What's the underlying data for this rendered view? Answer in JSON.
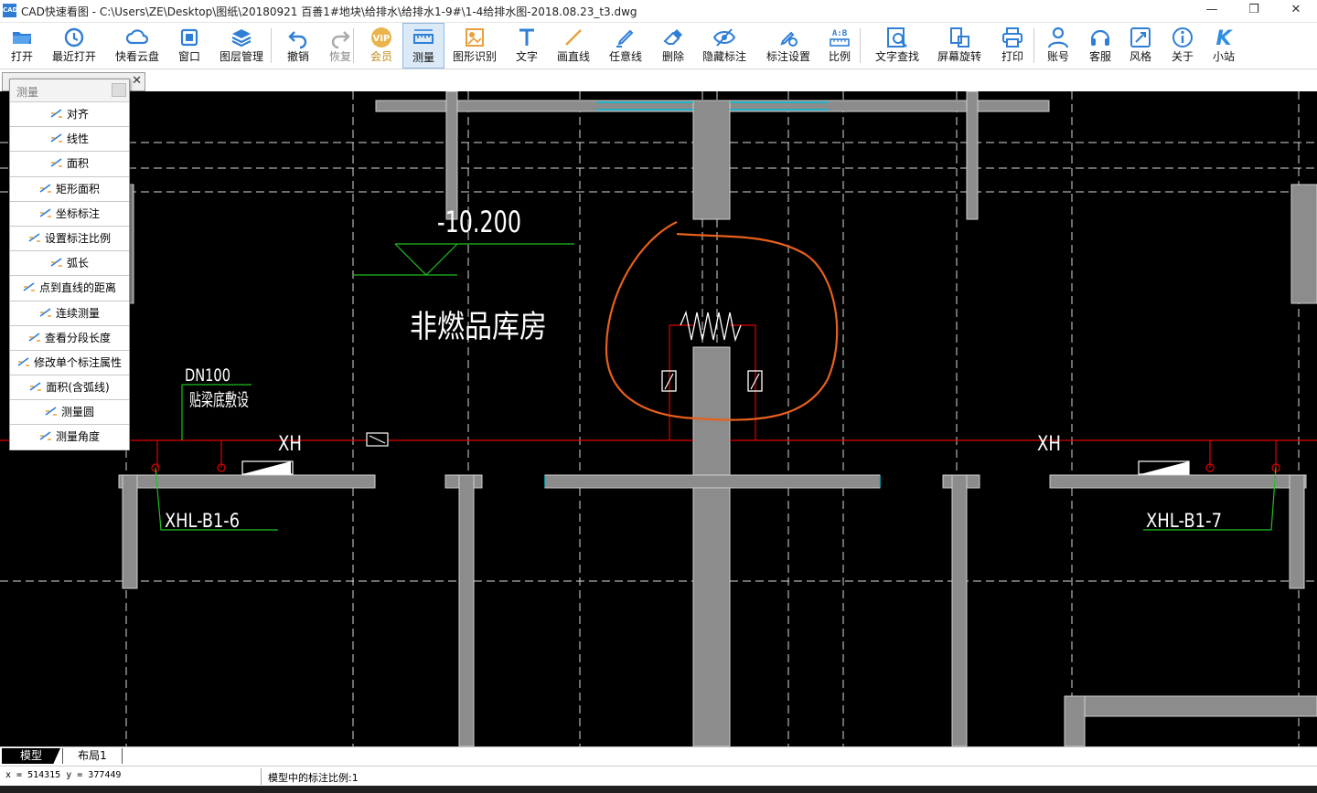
{
  "window": {
    "app_name": "CAD快速看图",
    "file_path": "C:\\Users\\ZE\\Desktop\\图纸\\20180921 百善1#地块\\给排水\\给排水1-9#\\1-4给排水图-2018.08.23_t3.dwg",
    "icon_text": "CAD",
    "controls": [
      "—",
      "❐",
      "✕"
    ]
  },
  "toolbar": [
    {
      "label": "打开",
      "icon": "folder-open"
    },
    {
      "label": "最近打开",
      "icon": "history"
    },
    {
      "label": "快看云盘",
      "icon": "cloud"
    },
    {
      "label": "窗口",
      "icon": "window"
    },
    {
      "label": "图层管理",
      "icon": "layers"
    },
    {
      "label": "撤销",
      "icon": "undo"
    },
    {
      "label": "恢复",
      "icon": "redo"
    },
    {
      "label": "会员",
      "icon": "vip"
    },
    {
      "label": "测量",
      "icon": "ruler"
    },
    {
      "label": "图形识别",
      "icon": "shape-recognize"
    },
    {
      "label": "文字",
      "icon": "text"
    },
    {
      "label": "画直线",
      "icon": "line"
    },
    {
      "label": "任意线",
      "icon": "pen"
    },
    {
      "label": "删除",
      "icon": "eraser"
    },
    {
      "label": "隐藏标注",
      "icon": "eye-hide"
    },
    {
      "label": "标注设置",
      "icon": "annotation-settings"
    },
    {
      "label": "比例",
      "icon": "scale"
    },
    {
      "label": "文字查找",
      "icon": "text-search"
    },
    {
      "label": "屏幕旋转",
      "icon": "rotate-screen"
    },
    {
      "label": "打印",
      "icon": "printer"
    },
    {
      "label": "账号",
      "icon": "user"
    },
    {
      "label": "客服",
      "icon": "headset"
    },
    {
      "label": "风格",
      "icon": "style"
    },
    {
      "label": "关于",
      "icon": "info"
    },
    {
      "label": "小站",
      "icon": "k-logo"
    }
  ],
  "tab": {
    "close": "✕"
  },
  "measure_panel": {
    "title": "测量",
    "items": [
      "对齐",
      "线性",
      "面积",
      "矩形面积",
      "坐标标注",
      "设置标注比例",
      "弧长",
      "点到直线的距离",
      "连续测量",
      "查看分段长度",
      "修改单个标注属性",
      "面积(含弧线)",
      "测量圆",
      "测量角度"
    ]
  },
  "drawing": {
    "elevation": "-10.200",
    "room_name": "非燃品库房",
    "pipe_size": "DN100",
    "pipe_note": "贴梁底敷设",
    "pipe_label_left": "XH",
    "pipe_label_right": "XH",
    "riser_left": "XHL-B1-6",
    "riser_right": "XHL-B1-7"
  },
  "layout_tabs": [
    "模型",
    "布局1"
  ],
  "status": {
    "coords": "x = 514315  y = 377449",
    "scale_text": "模型中的标注比例:1"
  },
  "colors": {
    "pipe_red": "#e00000",
    "leader_green": "#20c020",
    "wall_gray": "#8c8c8c",
    "markup_orange": "#e8601c",
    "active_tool_bg": "#dceaf8"
  }
}
